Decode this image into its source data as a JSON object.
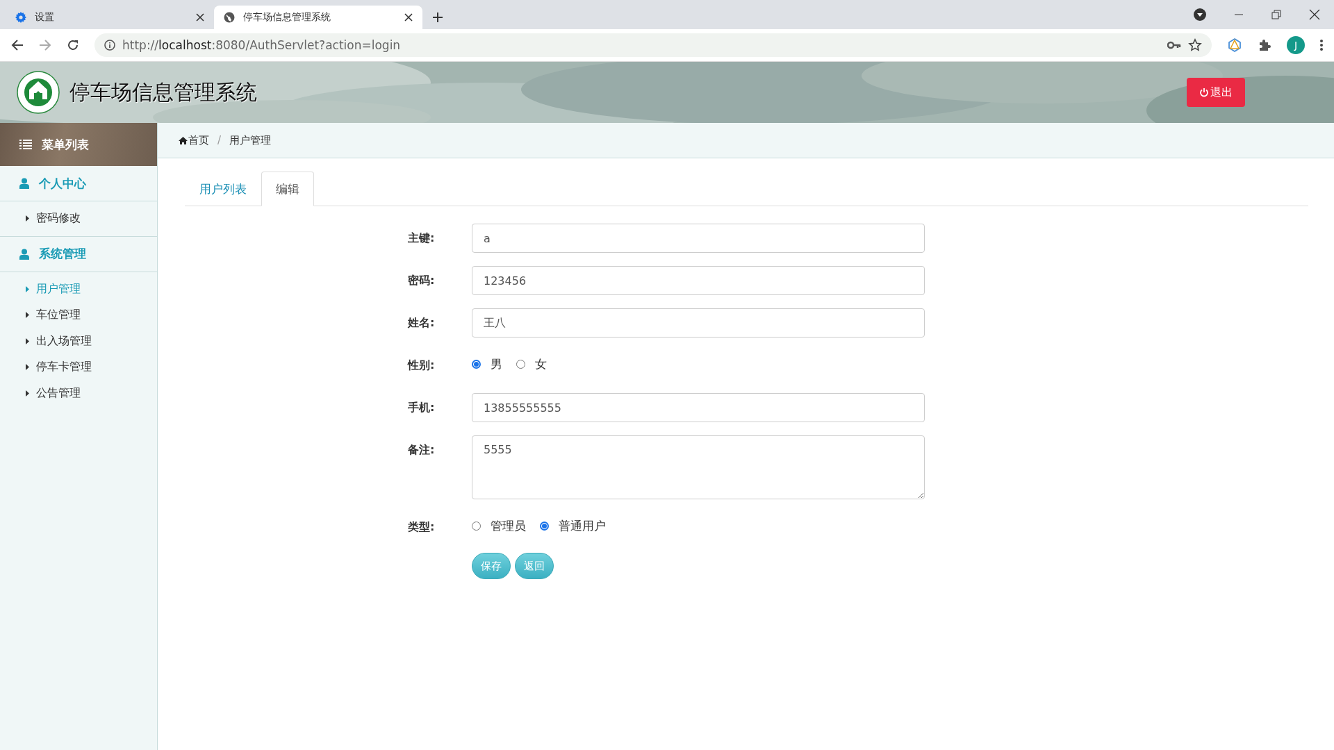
{
  "browser": {
    "tabs": [
      {
        "title": "设置",
        "selected": false,
        "kind": "settings"
      },
      {
        "title": "停车场信息管理系统",
        "selected": true,
        "kind": "globe"
      }
    ],
    "url": {
      "scheme": "http://",
      "host": "localhost",
      "rest": ":8080/AuthServlet?action=login"
    },
    "profile": "J"
  },
  "header": {
    "title": "停车场信息管理系统",
    "logout": "退出"
  },
  "sidebar": {
    "title": "菜单列表",
    "sections": [
      {
        "title": "个人中心",
        "items": [
          {
            "label": "密码修改",
            "selected": false
          }
        ]
      },
      {
        "title": "系统管理",
        "items": [
          {
            "label": "用户管理",
            "selected": true
          },
          {
            "label": "车位管理",
            "selected": false
          },
          {
            "label": "出入场管理",
            "selected": false
          },
          {
            "label": "停车卡管理",
            "selected": false
          },
          {
            "label": "公告管理",
            "selected": false
          }
        ]
      }
    ]
  },
  "breadcrumb": [
    "首页",
    "用户管理"
  ],
  "breadcrumb_separator": "/",
  "tabs": [
    {
      "label": "用户列表",
      "selected": false
    },
    {
      "label": "编辑",
      "selected": true
    }
  ],
  "form": {
    "fields": [
      {
        "label": "主键:",
        "kind": "text",
        "value": "a"
      },
      {
        "label": "密码:",
        "kind": "text",
        "value": "123456"
      },
      {
        "label": "姓名:",
        "kind": "text",
        "value": "王八"
      },
      {
        "label": "性别:",
        "kind": "radio",
        "options": [
          {
            "label": "男",
            "selected": true
          },
          {
            "label": "女",
            "selected": false
          }
        ]
      },
      {
        "label": "手机:",
        "kind": "text",
        "value": "13855555555"
      },
      {
        "label": "备注:",
        "kind": "textarea",
        "value": "5555"
      },
      {
        "label": "类型:",
        "kind": "radio",
        "options": [
          {
            "label": "管理员",
            "selected": false
          },
          {
            "label": "普通用户",
            "selected": true
          }
        ]
      }
    ],
    "buttons": [
      "保存",
      "返回"
    ]
  }
}
